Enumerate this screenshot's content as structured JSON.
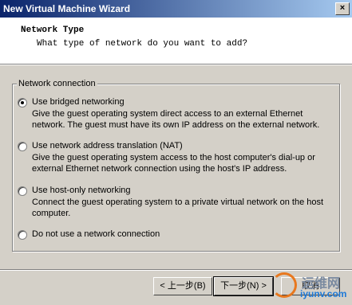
{
  "window": {
    "title": "New Virtual Machine Wizard",
    "close_glyph": "×"
  },
  "header": {
    "title": "Network Type",
    "subtitle": "What type of network do you want to add?"
  },
  "group": {
    "legend": "Network connection",
    "options": [
      {
        "label": "Use bridged networking",
        "selected": true,
        "description": "Give the guest operating system direct access to an external Ethernet network. The guest must have its own IP address on the external network."
      },
      {
        "label": "Use network address translation (NAT)",
        "selected": false,
        "description": "Give the guest operating system access to the host computer's dial-up or external Ethernet network connection using the host's IP address."
      },
      {
        "label": "Use host-only networking",
        "selected": false,
        "description": "Connect the guest operating system to a private virtual network on the host computer."
      },
      {
        "label": "Do not use a network connection",
        "selected": false,
        "description": ""
      }
    ]
  },
  "buttons": {
    "back": "< 上一步(B)",
    "next": "下一步(N) >",
    "cancel": "取消"
  },
  "watermark": {
    "cn": "运维网",
    "en": "iyunv.com"
  },
  "colors": {
    "title_start": "#0a246a",
    "title_end": "#a6caf0",
    "face": "#d4d0c8"
  }
}
